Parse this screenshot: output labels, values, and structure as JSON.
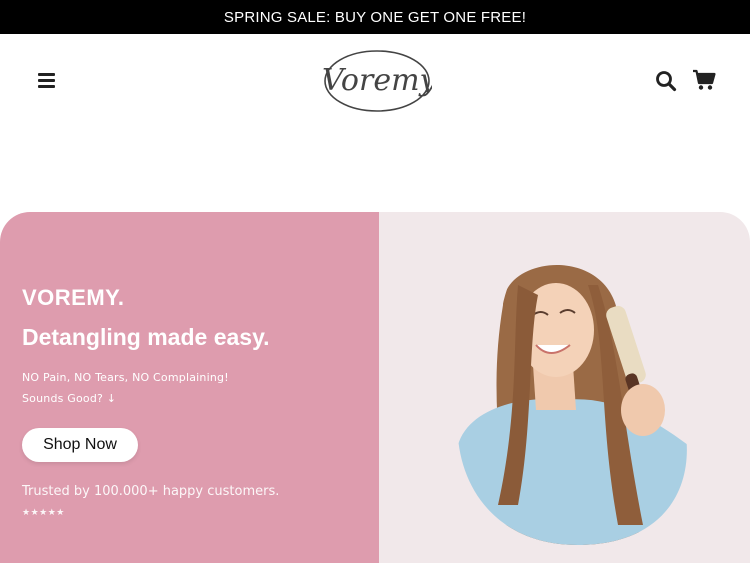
{
  "announcement": {
    "text": "SPRING SALE: BUY ONE GET ONE FREE!"
  },
  "header": {
    "logo_text": "Voremy",
    "menu_icon": "hamburger-menu-icon",
    "search_icon": "search-icon",
    "cart_icon": "cart-icon"
  },
  "hero": {
    "brand": "VOREMY.",
    "headline": "Detangling made easy.",
    "subline1": "NO Pain, NO Tears, NO Complaining!",
    "subline2": "Sounds Good? ↓",
    "cta_label": "Shop Now",
    "trusted": "Trusted by 100.000+ happy customers.",
    "stars": "★★★★★",
    "image_alt": "woman-brushing-hair"
  },
  "colors": {
    "announcement_bg": "#000000",
    "hero_left_bg": "#de9cae",
    "hero_right_bg": "#f1e8ea",
    "text_light": "#ffffff"
  }
}
